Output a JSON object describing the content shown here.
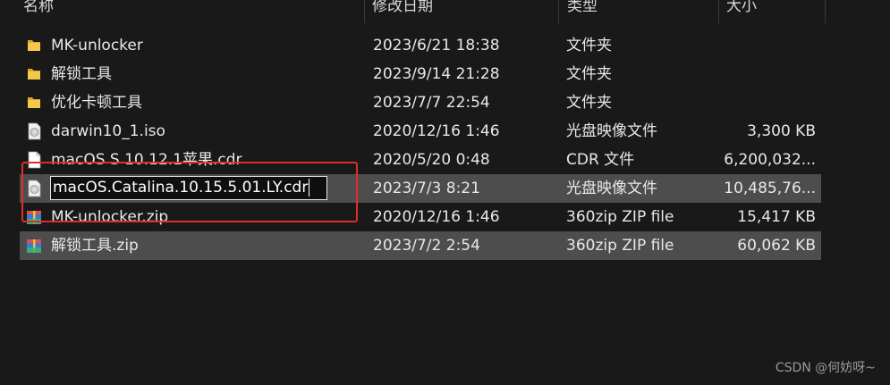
{
  "columns": {
    "name": "名称",
    "date": "修改日期",
    "type": "类型",
    "size": "大小"
  },
  "files": [
    {
      "name": "MK-unlocker",
      "date": "2023/6/21 18:38",
      "type": "文件夹",
      "size": "",
      "icon": "folder-icon"
    },
    {
      "name": "解锁工具",
      "date": "2023/9/14 21:28",
      "type": "文件夹",
      "size": "",
      "icon": "folder-icon"
    },
    {
      "name": "优化卡顿工具",
      "date": "2023/7/7 22:54",
      "type": "文件夹",
      "size": "",
      "icon": "folder-icon"
    },
    {
      "name": "darwin10_1.iso",
      "date": "2020/12/16 1:46",
      "type": "光盘映像文件",
      "size": "3,300 KB",
      "icon": "disc-image-icon"
    },
    {
      "name": "macOS S 10.12.1苹果.cdr",
      "date": "2020/5/20 0:48",
      "type": "CDR 文件",
      "size": "6,200,032...",
      "icon": "file-icon"
    },
    {
      "name": "macOS.Catalina.10.15.5.01.LY.cdr",
      "date": "2023/7/3 8:21",
      "type": "光盘映像文件",
      "size": "10,485,76...",
      "icon": "disc-image-icon"
    },
    {
      "name": "MK-unlocker.zip",
      "date": "2020/12/16 1:46",
      "type": "360zip ZIP file",
      "size": "15,417 KB",
      "icon": "zip-archive-icon"
    },
    {
      "name": "解锁工具.zip",
      "date": "2023/7/2 2:54",
      "type": "360zip ZIP file",
      "size": "60,062 KB",
      "icon": "zip-archive-icon"
    }
  ],
  "rename_value": "macOS.Catalina.10.15.5.01.LY.cdr",
  "watermark": "CSDN @何妨呀~",
  "colors": {
    "background": "#191919",
    "selected_row": "#4d4d4d",
    "highlight_border": "#e22c2c",
    "folder": "#f2c14e"
  }
}
